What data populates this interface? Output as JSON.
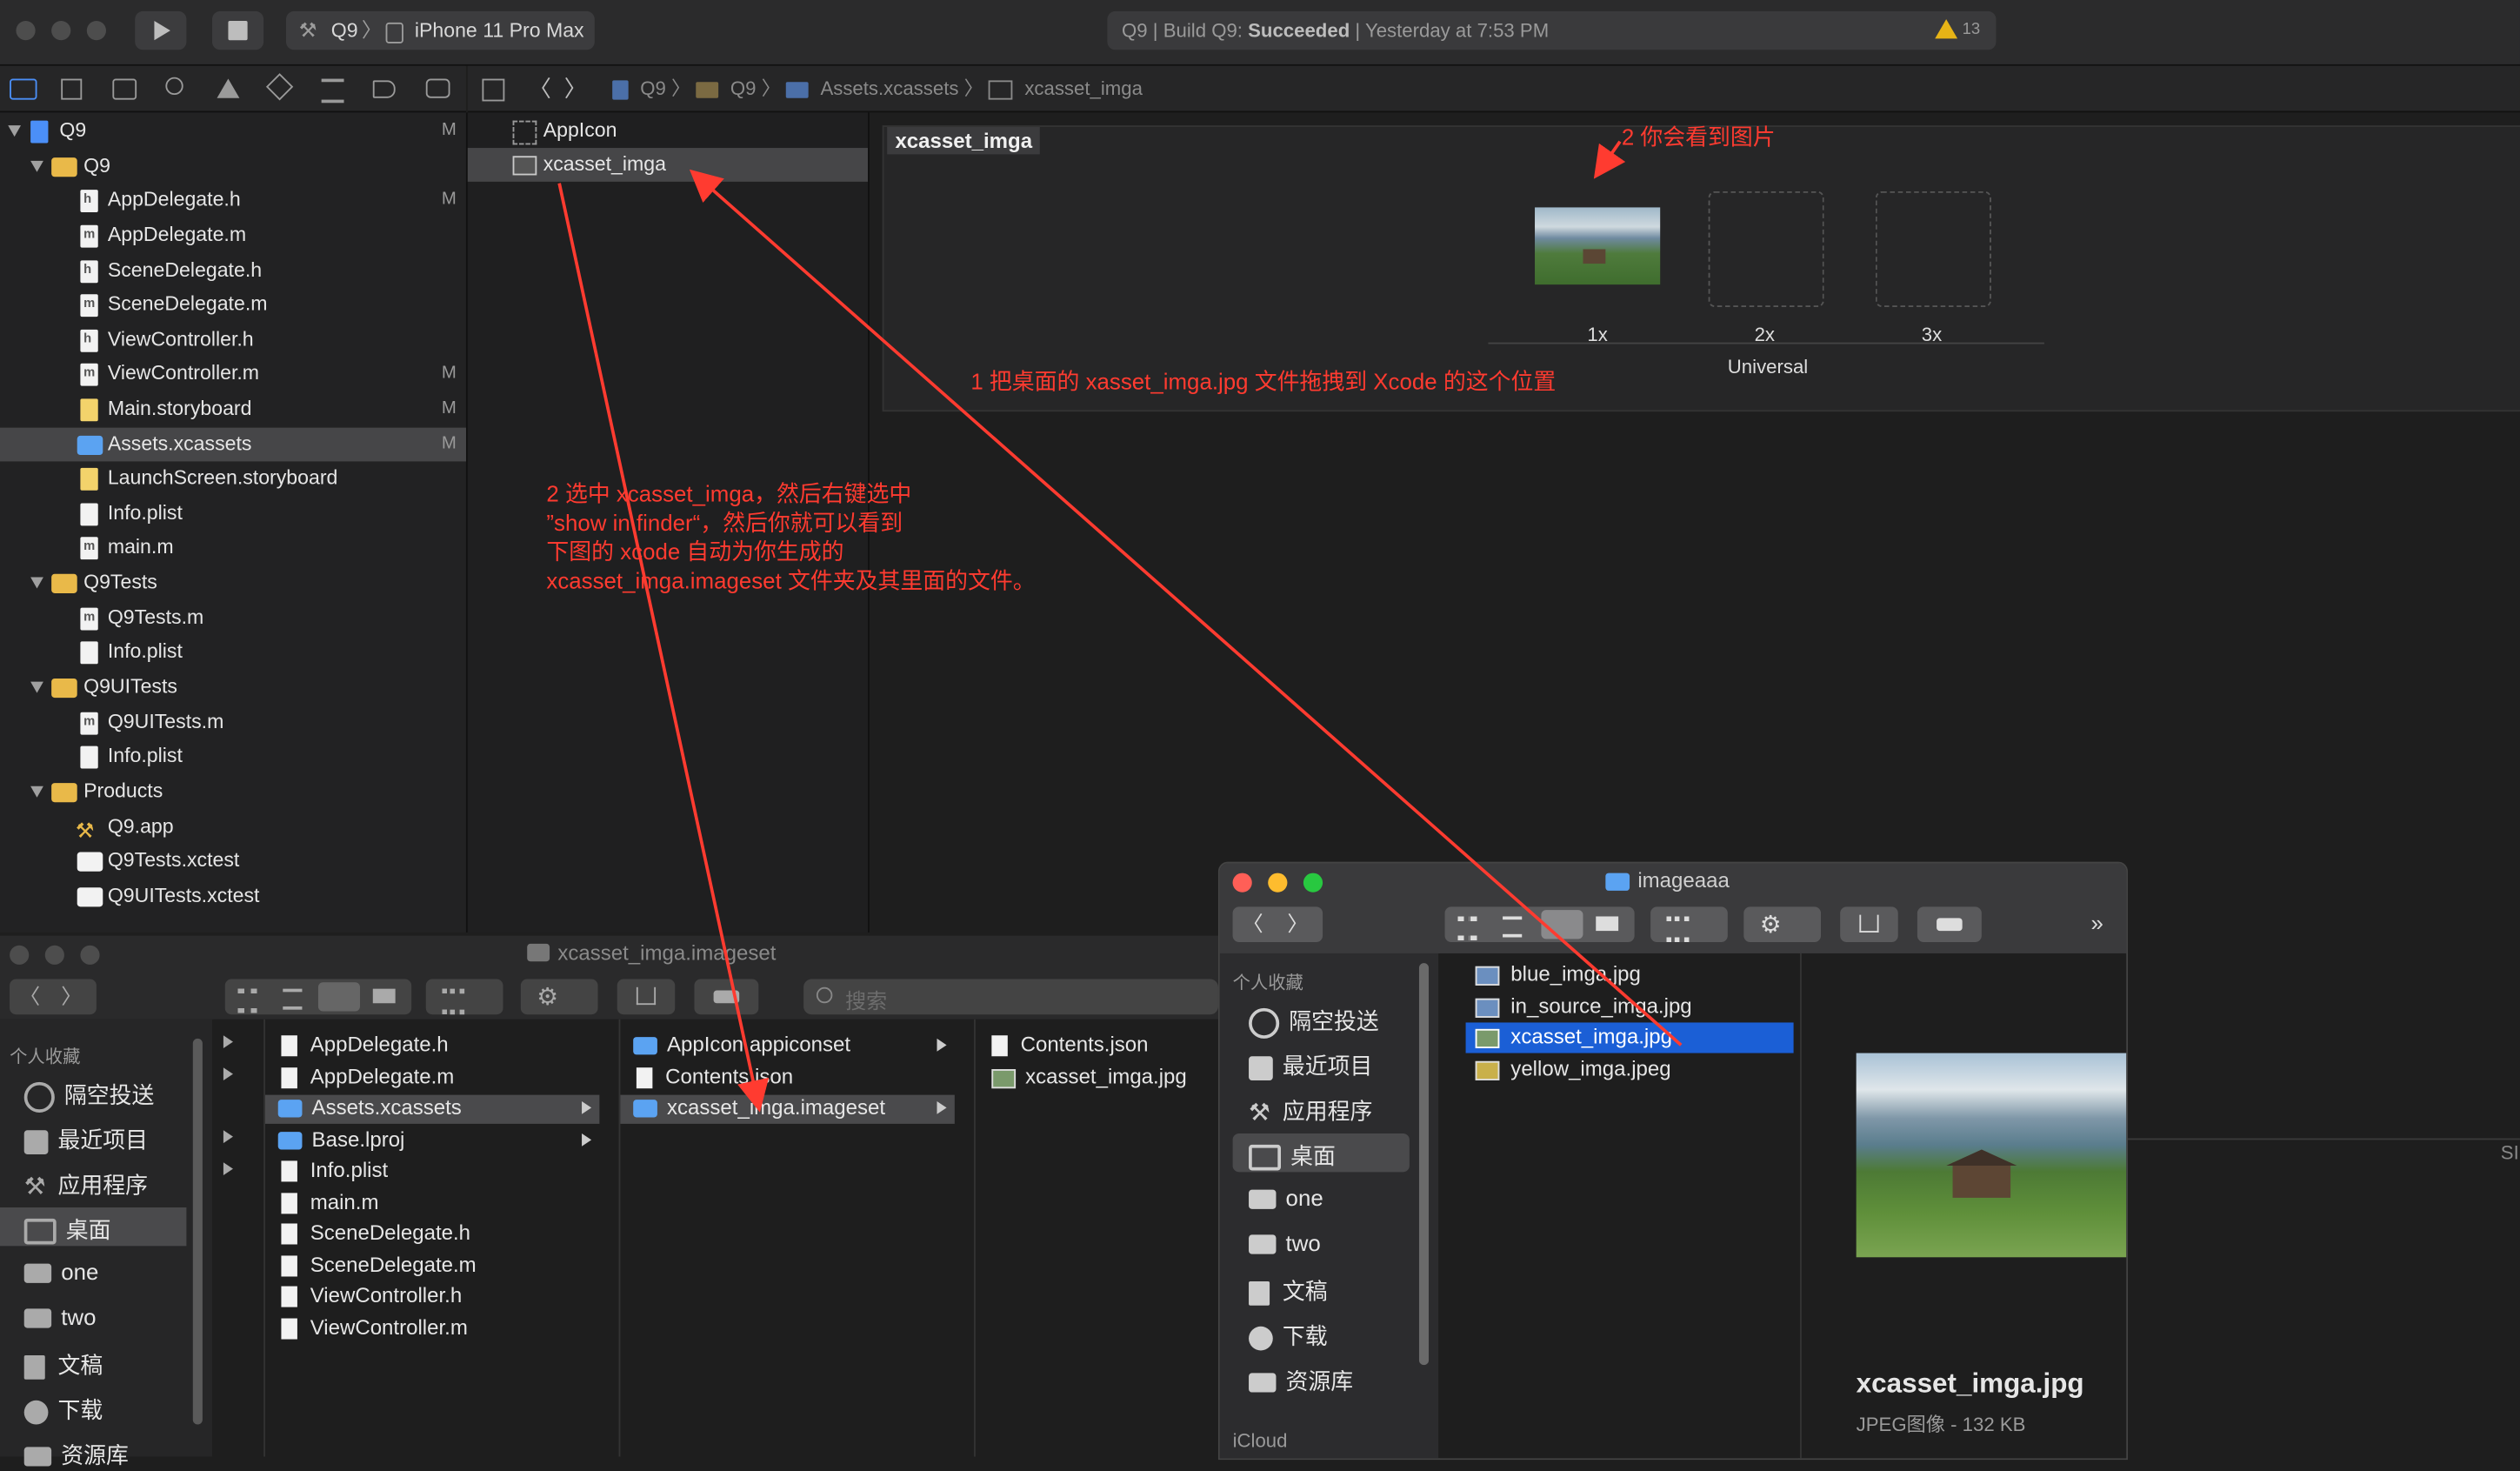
{
  "toolbar": {
    "scheme": "Q9",
    "device": "iPhone 11 Pro Max",
    "status_prefix": "Q9 | Build Q9: ",
    "status_result": "Succeeded",
    "status_time": " | Yesterday at 7:53 PM",
    "warning_count": "13"
  },
  "jumpbar": {
    "path": [
      "Q9",
      "Q9",
      "Assets.xcassets",
      "xcasset_imga"
    ]
  },
  "navigator": {
    "items": [
      {
        "label": "Q9",
        "mark": "M"
      },
      {
        "label": "Q9",
        "mark": ""
      },
      {
        "label": "AppDelegate.h",
        "mark": "M"
      },
      {
        "label": "AppDelegate.m",
        "mark": ""
      },
      {
        "label": "SceneDelegate.h",
        "mark": ""
      },
      {
        "label": "SceneDelegate.m",
        "mark": ""
      },
      {
        "label": "ViewController.h",
        "mark": ""
      },
      {
        "label": "ViewController.m",
        "mark": "M"
      },
      {
        "label": "Main.storyboard",
        "mark": "M"
      },
      {
        "label": "Assets.xcassets",
        "mark": "M"
      },
      {
        "label": "LaunchScreen.storyboard",
        "mark": ""
      },
      {
        "label": "Info.plist",
        "mark": ""
      },
      {
        "label": "main.m",
        "mark": ""
      },
      {
        "label": "Q9Tests",
        "mark": ""
      },
      {
        "label": "Q9Tests.m",
        "mark": ""
      },
      {
        "label": "Info.plist",
        "mark": ""
      },
      {
        "label": "Q9UITests",
        "mark": ""
      },
      {
        "label": "Q9UITests.m",
        "mark": ""
      },
      {
        "label": "Info.plist",
        "mark": ""
      },
      {
        "label": "Products",
        "mark": ""
      },
      {
        "label": "Q9.app",
        "mark": ""
      },
      {
        "label": "Q9Tests.xctest",
        "mark": ""
      },
      {
        "label": "Q9UITests.xctest",
        "mark": ""
      }
    ]
  },
  "assets": {
    "items": [
      "AppIcon",
      "xcasset_imga"
    ]
  },
  "editor": {
    "set_name": "xcasset_imga",
    "slots": [
      "1x",
      "2x",
      "3x"
    ],
    "group": "Universal"
  },
  "annotations": {
    "a1": "2 你会看到图片",
    "a2": "1 把桌面的 xasset_imga.jpg 文件拖拽到 Xcode 的这个位置",
    "a3_lines": [
      "2 选中 xcasset_imga，然后右键选中",
      "”show in finder“，然后你就可以看到",
      "下图的 xcode 自动为你生成的",
      "xcasset_imga.imageset 文件夹及其里面的文件。"
    ]
  },
  "finder1": {
    "title": "xcasset_imga.imageset",
    "search_placeholder": "搜索",
    "sidebar_header": "个人收藏",
    "sidebar": [
      "隔空投送",
      "最近项目",
      "应用程序",
      "桌面",
      "one",
      "two",
      "文稿",
      "下载",
      "资源库"
    ],
    "col1": [
      "AppDelegate.h",
      "AppDelegate.m",
      "Assets.xcassets",
      "Base.lproj",
      "Info.plist",
      "main.m",
      "SceneDelegate.h",
      "SceneDelegate.m",
      "ViewController.h",
      "ViewController.m"
    ],
    "col2": [
      "AppIcon.appiconset",
      "Contents.json",
      "xcasset_imga.imageset"
    ],
    "col3": [
      "Contents.json",
      "xcasset_imga.jpg"
    ]
  },
  "finder2": {
    "title": "imageaaa",
    "sidebar_header": "个人收藏",
    "sidebar": [
      "隔空投送",
      "最近项目",
      "应用程序",
      "桌面",
      "one",
      "two",
      "文稿",
      "下载",
      "资源库"
    ],
    "icloud": "iCloud",
    "files": [
      "blue_imga.jpg",
      "in_source_imga.jpg",
      "xcasset_imga.jpg",
      "yellow_imga.jpeg"
    ],
    "preview_name": "xcasset_imga.jpg",
    "preview_info": "JPEG图像 - 132 KB"
  },
  "colors": {
    "accent": "#1b5fd6",
    "annotation": "#ff3b30",
    "folder": "#e9b949"
  }
}
